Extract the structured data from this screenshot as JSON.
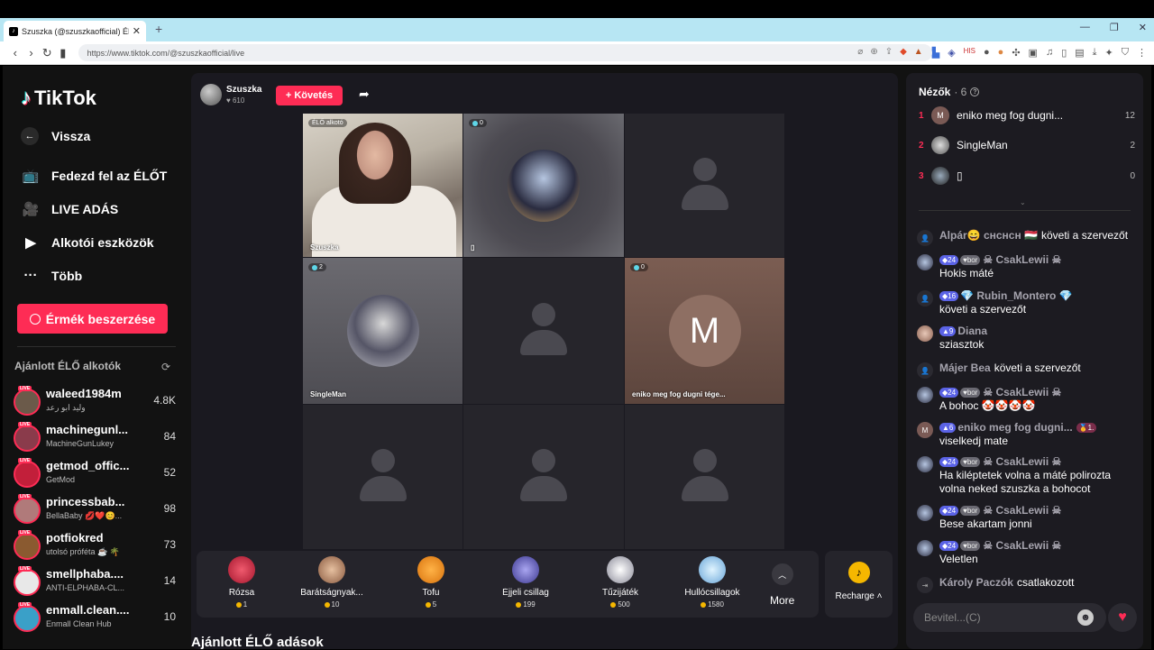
{
  "browser": {
    "tab_title": "Szuszka (@szuszkaofficial) ÉL...",
    "url": "https://www.tiktok.com/@szuszkaofficial/live"
  },
  "sidebar": {
    "logo": "TikTok",
    "back": "Vissza",
    "nav": [
      "Fedezd fel az ÉLŐT",
      "LIVE ADÁS",
      "Alkotói eszközök",
      "Több"
    ],
    "coin_button": "Érmék beszerzése",
    "suggested_title": "Ajánlott ÉLŐ alkotók",
    "creators": [
      {
        "name": "waleed1984m",
        "sub": "وليد ابو رعد",
        "count": "4.8K",
        "color": "#6b5a4a"
      },
      {
        "name": "machinegunl...",
        "sub": "MachineGunLukey",
        "count": "84",
        "color": "#8a3b4b"
      },
      {
        "name": "getmod_offic...",
        "sub": "GetMod",
        "count": "52",
        "color": "#c21f3a"
      },
      {
        "name": "princessbab...",
        "sub": "BellaBaby 💋❤️😊...",
        "count": "98",
        "color": "#b07a7a"
      },
      {
        "name": "potfiokred",
        "sub": "utolsó próféta ☕ 🌴",
        "count": "73",
        "color": "#8a5a30"
      },
      {
        "name": "smellphaba....",
        "sub": "ANTI-ELPHABA-CL...",
        "count": "14",
        "color": "#e8e8e8"
      },
      {
        "name": "enmall.clean....",
        "sub": "Enmall Clean Hub",
        "count": "10",
        "color": "#3aa0c8"
      }
    ]
  },
  "stream": {
    "host_name": "Szuszka",
    "host_likes": "610",
    "follow_label": "+ Követés",
    "grid": {
      "cell1_badge": "ÉLŐ alkotó",
      "cell1_label": "Szuszka",
      "cell2_count": "0",
      "cell2_label": "▯",
      "cell4_count": "2",
      "cell4_label": "SingleMan",
      "cell6_count": "0",
      "cell6_initial": "M",
      "cell6_label": "eniko meg fog dugni tége..."
    },
    "gifts": [
      {
        "name": "Rózsa",
        "price": "1",
        "color": "#d9334a"
      },
      {
        "name": "Barátságnyak...",
        "price": "10",
        "color": "#b58a6a"
      },
      {
        "name": "Tofu",
        "price": "5",
        "color": "#e68a2e"
      },
      {
        "name": "Éjjeli csillag",
        "price": "199",
        "color": "#6e6ac8"
      },
      {
        "name": "Tűzijáték",
        "price": "500",
        "color": "#d8d8e0"
      },
      {
        "name": "Hullócsillagok",
        "price": "1580",
        "color": "#9ad0f0"
      }
    ],
    "more_label": "More",
    "recharge_label": "Recharge",
    "bottom_title": "Ajánlott ÉLŐ adások"
  },
  "viewers": {
    "title": "Nézők",
    "count": "· 6",
    "list": [
      {
        "rank": "1",
        "name": "eniko meg fog dugni...",
        "count": "12",
        "initial": "M",
        "color": "#7a5a55"
      },
      {
        "rank": "2",
        "name": "SingleMan",
        "count": "2",
        "initial": "",
        "color": "#888"
      },
      {
        "rank": "3",
        "name": "▯",
        "count": "0",
        "initial": "",
        "color": "#333"
      }
    ]
  },
  "chat": {
    "m1": {
      "user": "Alpár😄 ᴄʜᴄʜᴄʜ 🇭🇺",
      "text": "követi a szervezőt"
    },
    "m2": {
      "lvl": "24",
      "fan": "bor",
      "user": "☠ CsakLewii ☠",
      "text": "Hokis máté"
    },
    "m3": {
      "lvl": "16",
      "user": "💎 Rubin_Montero 💎",
      "text": "követi a szervezőt"
    },
    "m4": {
      "lvl": "9",
      "user": "Diana",
      "text": "sziasztok"
    },
    "m5": {
      "user": "Májer Bea",
      "text": "követi a szervezőt"
    },
    "m6": {
      "lvl": "24",
      "fan": "bor",
      "user": "☠ CsakLewii ☠",
      "text": "A bohoc 🤡🤡🤡🤡"
    },
    "m7": {
      "lvl": "6",
      "user": "eniko meg fog dugni...",
      "badge": "🥇1.",
      "text": "viselkedj mate"
    },
    "m8": {
      "lvl": "24",
      "fan": "bor",
      "user": "☠ CsakLewii ☠",
      "text": "Ha kiléptetek volna a máté polirozta volna neked szuszka a bohocot"
    },
    "m9": {
      "lvl": "24",
      "fan": "bor",
      "user": "☠ CsakLewii ☠",
      "text": "Bese akartam jonni"
    },
    "m10": {
      "lvl": "24",
      "fan": "bor",
      "user": "☠ CsakLewii ☠",
      "text": "Veletlen"
    },
    "m11": {
      "user": "Károly Paczók",
      "text": "csatlakozott"
    },
    "input_placeholder": "Bevitel...(C)"
  }
}
